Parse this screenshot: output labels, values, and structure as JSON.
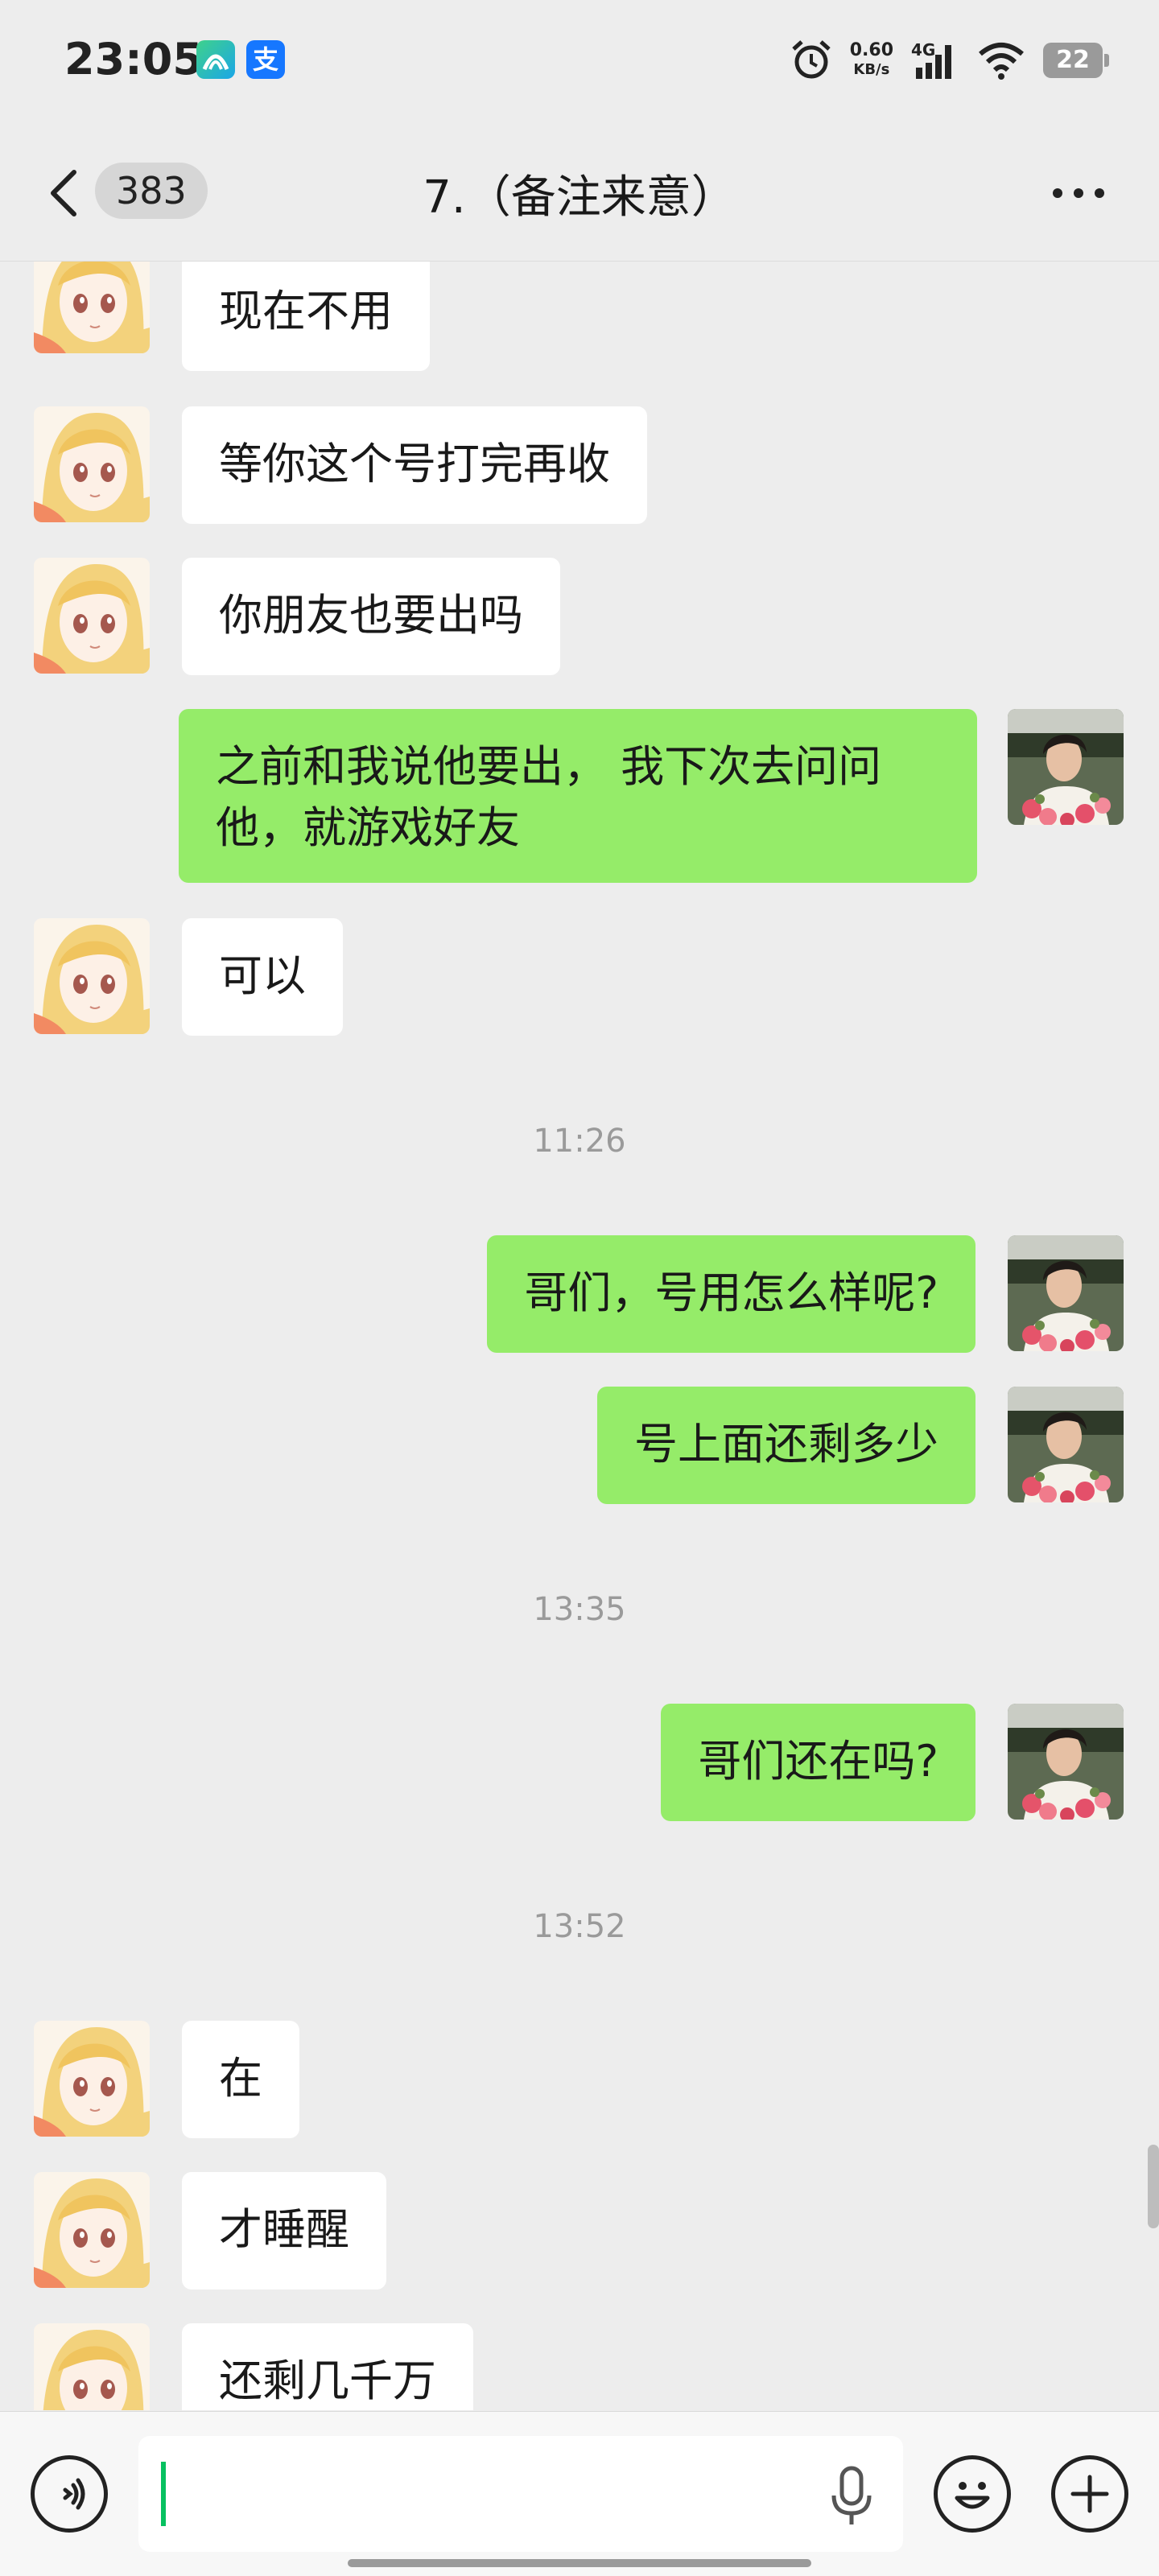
{
  "status_bar": {
    "time": "23:05",
    "app_icons": [
      "ai-assistant-icon",
      "alipay-icon"
    ],
    "alipay_glyph": "支",
    "net_speed_value": "0.60",
    "net_speed_unit": "KB/s",
    "signal": "4G",
    "battery": "22"
  },
  "header": {
    "unread_count": "383",
    "title": "7.（备注来意）",
    "colors": {
      "background": "#ededed"
    }
  },
  "messages": [
    {
      "side": "in",
      "text": "现在不用"
    },
    {
      "side": "in",
      "text": "等你这个号打完再收"
    },
    {
      "side": "in",
      "text": "你朋友也要出吗"
    },
    {
      "side": "out",
      "line1": "之前和我说他要出， 我下次去问问",
      "line2": "他，就游戏好友"
    },
    {
      "side": "in",
      "text": "可以"
    },
    {
      "time": "11:26"
    },
    {
      "side": "out",
      "text": "哥们，号用怎么样呢?"
    },
    {
      "side": "out",
      "text": "号上面还剩多少"
    },
    {
      "time": "13:35"
    },
    {
      "side": "out",
      "text": "哥们还在吗?"
    },
    {
      "time": "13:52"
    },
    {
      "side": "in",
      "text": "在"
    },
    {
      "side": "in",
      "text": "才睡醒"
    },
    {
      "side": "in",
      "text": "还剩几千万"
    }
  ],
  "input_bar": {
    "value": "",
    "left_button": "voice-icon",
    "mic": "microphone-icon",
    "emoji": "emoji-icon",
    "plus": "add-icon"
  },
  "colors": {
    "outgoing_bubble": "#95ec69",
    "incoming_bubble": "#ffffff",
    "cursor": "#07c160"
  }
}
